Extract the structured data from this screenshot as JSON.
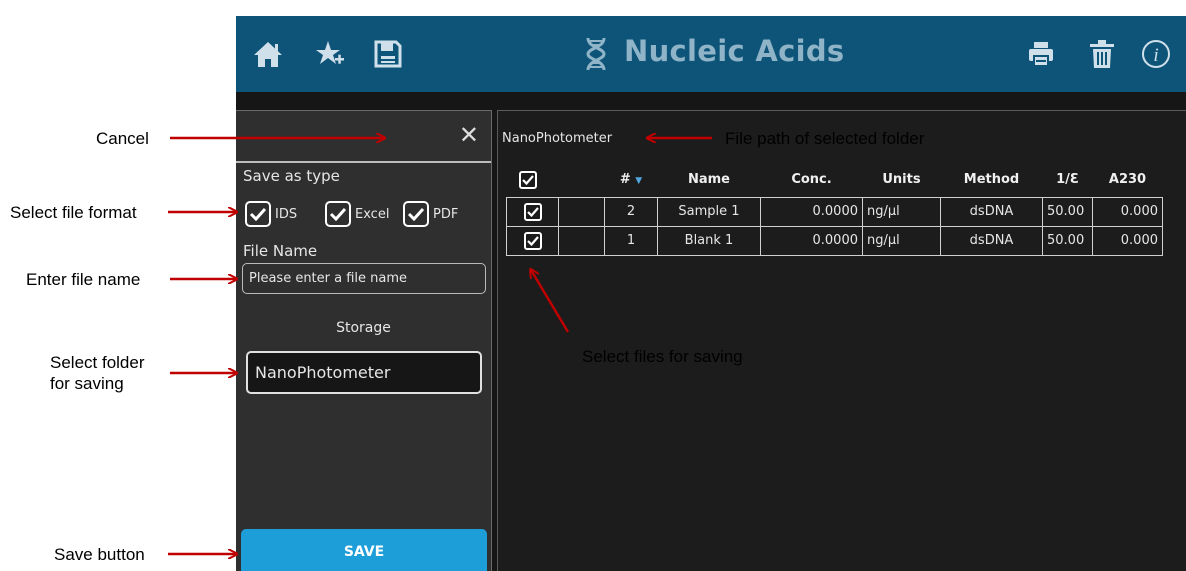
{
  "annotations": {
    "cancel": "Cancel",
    "select_file_format": "Select file format",
    "enter_file_name": "Enter file name",
    "select_folder_line1": "Select folder",
    "select_folder_line2": "for saving",
    "save_button": "Save button",
    "file_path": "File path of selected folder",
    "select_files": "Select files for saving"
  },
  "header": {
    "title": "Nucleic Acids",
    "left_icons": [
      "home-icon",
      "favorites-icon",
      "save-icon"
    ],
    "title_icon": "dna-icon",
    "right_icons": [
      "print-icon",
      "delete-icon",
      "info-icon"
    ]
  },
  "save_panel": {
    "save_as_type_label": "Save as type",
    "formats": [
      {
        "label": "IDS",
        "checked": true
      },
      {
        "label": "Excel",
        "checked": true
      },
      {
        "label": "PDF",
        "checked": true
      }
    ],
    "file_name_label": "File Name",
    "file_name_placeholder": "Please enter a file name",
    "storage_label": "Storage",
    "folder": "NanoPhotometer",
    "save_label": "SAVE"
  },
  "file_list": {
    "path": "NanoPhotometer",
    "columns": [
      "#",
      "Name",
      "Conc.",
      "Units",
      "Method",
      "1/Ɛ",
      "A230"
    ],
    "rows": [
      {
        "checked": true,
        "num": "2",
        "name": "Sample 1",
        "conc": "0.0000",
        "units": "ng/µl",
        "method": "dsDNA",
        "inv_e": "50.00",
        "a230": "0.000"
      },
      {
        "checked": true,
        "num": "1",
        "name": "Blank 1",
        "conc": "0.0000",
        "units": "ng/µl",
        "method": "dsDNA",
        "inv_e": "50.00",
        "a230": "0.000"
      }
    ]
  },
  "colors": {
    "header_bg": "#0e5479",
    "accent": "#1e9ed9",
    "annotation_arrow": "#c00000"
  }
}
